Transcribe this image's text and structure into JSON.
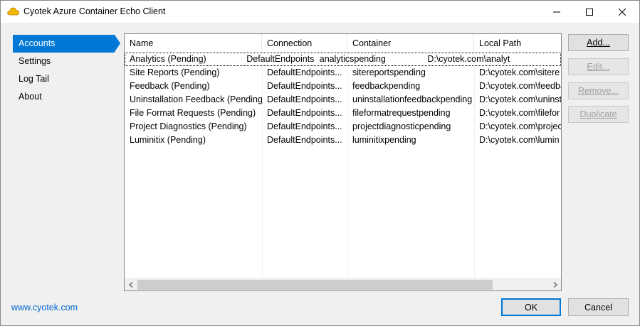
{
  "window": {
    "title": "Cyotek Azure Container Echo Client",
    "accent": "#0078d7"
  },
  "sidebar": {
    "items": [
      {
        "label": "Accounts",
        "selected": true
      },
      {
        "label": "Settings",
        "selected": false
      },
      {
        "label": "Log Tail",
        "selected": false
      },
      {
        "label": "About",
        "selected": false
      }
    ]
  },
  "list": {
    "columns": [
      "Name",
      "Connection",
      "Container",
      "Local Path"
    ],
    "rows": [
      [
        "Analytics (Pending)",
        "DefaultEndpoints...",
        "analyticspending",
        "D:\\cyotek.com\\analyt"
      ],
      [
        "Site Reports (Pending)",
        "DefaultEndpoints...",
        "sitereportspending",
        "D:\\cyotek.com\\sitere"
      ],
      [
        "Feedback (Pending)",
        "DefaultEndpoints...",
        "feedbackpending",
        "D:\\cyotek.com\\feedba"
      ],
      [
        "Uninstallation Feedback (Pending)",
        "DefaultEndpoints...",
        "uninstallationfeedbackpending",
        "D:\\cyotek.com\\uninst"
      ],
      [
        "File Format Requests (Pending)",
        "DefaultEndpoints...",
        "fileformatrequestpending",
        "D:\\cyotek.com\\filefor"
      ],
      [
        "Project Diagnostics (Pending)",
        "DefaultEndpoints...",
        "projectdiagnosticpending",
        "D:\\cyotek.com\\projec"
      ],
      [
        "Luminitix (Pending)",
        "DefaultEndpoints...",
        "luminitixpending",
        "D:\\cyotek.com\\lumin"
      ]
    ]
  },
  "actions": {
    "add": "Add...",
    "edit": "Edit...",
    "remove": "Remove...",
    "duplicate": "Duplicate"
  },
  "footer": {
    "link": "www.cyotek.com",
    "ok": "OK",
    "cancel": "Cancel"
  }
}
